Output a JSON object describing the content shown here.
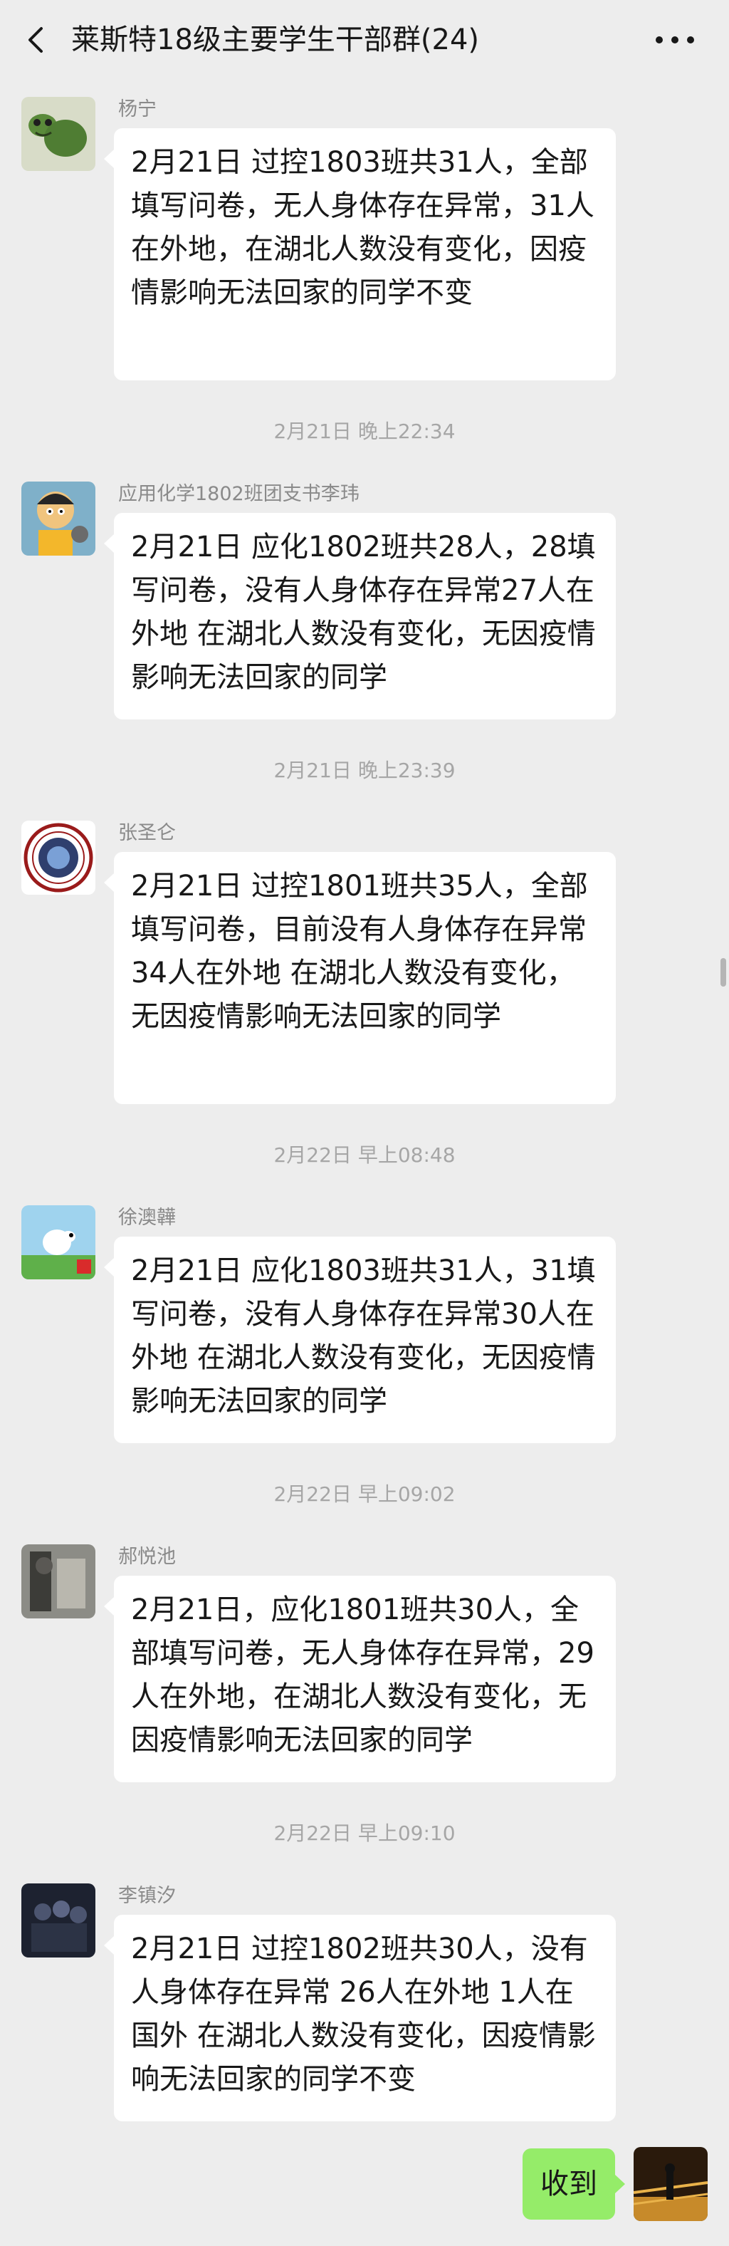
{
  "header": {
    "title": "莱斯特18级主要学生干部群(24)",
    "back_icon": "chevron-left-icon",
    "more_icon": "more-dots-icon"
  },
  "messages": [
    {
      "sender": "杨宁",
      "text": "2月21日 过控1803班共31人，全部填写问卷，无人身体存在异常，31人在外地，在湖北人数没有变化，因疫情影响无法回家的同学不变"
    },
    {
      "sender": "应用化学1802班团支书李玮",
      "text": "2月21日 应化1802班共28人，28填写问卷，没有人身体存在异常27人在外地 在湖北人数没有变化，无因疫情影响无法回家的同学"
    },
    {
      "sender": "张圣仑",
      "text": "2月21日 过控1801班共35人，全部填写问卷，目前没有人身体存在异常 34人在外地 在湖北人数没有变化，无因疫情影响无法回家的同学"
    },
    {
      "sender": "徐澳韡",
      "text": "2月21日 应化1803班共31人，31填写问卷，没有人身体存在异常30人在外地 在湖北人数没有变化，无因疫情影响无法回家的同学"
    },
    {
      "sender": "郝悦池",
      "text": "2月21日，应化1801班共30人，全部填写问卷，无人身体存在异常，29人在外地，在湖北人数没有变化，无因疫情影响无法回家的同学"
    },
    {
      "sender": "李镇汐",
      "text": "2月21日 过控1802班共30人，没有人身体存在异常 26人在外地 1人在国外 在湖北人数没有变化，因疫情影响无法回家的同学不变"
    }
  ],
  "timestamps": [
    "2月21日 晚上22:34",
    "2月21日 晚上23:39",
    "2月22日 早上08:48",
    "2月22日 早上09:02",
    "2月22日 早上09:10"
  ],
  "self_message": {
    "text": "收到"
  },
  "colors": {
    "background": "#ededed",
    "bubble_incoming": "#ffffff",
    "bubble_outgoing": "#95ec69",
    "meta_text": "#a6a6a6"
  }
}
